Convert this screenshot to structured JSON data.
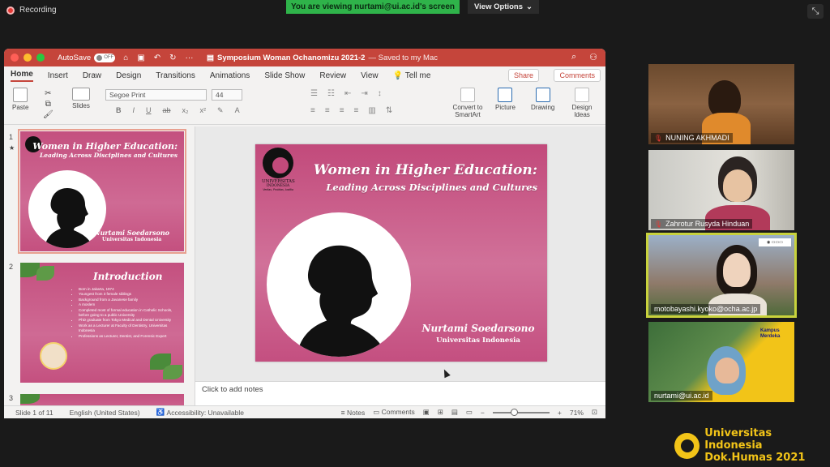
{
  "zoom": {
    "recording_label": "Recording",
    "viewing_banner": "You are viewing nurtami@ui.ac.id's screen",
    "view_options": "View Options"
  },
  "ppt": {
    "autosave_label": "AutoSave",
    "autosave_state": "OFF",
    "doc_title": "Symposium Woman Ochanomizu 2021-2",
    "doc_status": "— Saved to my Mac",
    "tabs": [
      "Home",
      "Insert",
      "Draw",
      "Design",
      "Transitions",
      "Animations",
      "Slide Show",
      "Review",
      "View",
      "Tell me"
    ],
    "share_label": "Share",
    "comments_label": "Comments",
    "ribbon": {
      "paste": "Paste",
      "slides": "Slides",
      "font_name": "Segoe Print",
      "font_size": "44",
      "convert_smartart": "Convert to SmartArt",
      "picture": "Picture",
      "drawing": "Drawing",
      "design_ideas": "Design Ideas"
    },
    "slide1": {
      "title_line1": "Women in Higher Education:",
      "title_line2": "Leading Across Disciplines and Cultures",
      "name": "Nurtami Soedarsono",
      "affiliation": "Universitas Indonesia",
      "logo_line1": "UNIVERSITAS",
      "logo_line2": "INDONESIA",
      "logo_line3": "Veritas, Probitas, Iustitia"
    },
    "slide2": {
      "title": "Introduction",
      "bullets": [
        "Born in Jakarta, 1974",
        "Youngest from 3 female siblings",
        "Background from a Javanese family",
        "A moslem",
        "Completed most of formal education in Catholic Schools, before going to a public University",
        "PhD graduate from Tokyo Medical and Dental University",
        "Work as a Lecturer at Faculty of Dentistry, Universitas Indonesia",
        "Professions as Lecturer, Dentist, and Forensic Expert"
      ]
    },
    "slide_numbers": [
      "1",
      "2",
      "3"
    ],
    "notes_placeholder": "Click to add notes",
    "status": {
      "slide_of": "Slide 1 of 11",
      "language": "English (United States)",
      "accessibility": "Accessibility: Unavailable",
      "notes": "Notes",
      "comments": "Comments",
      "zoom_level": "71%"
    }
  },
  "participants": [
    {
      "name": "NUNING AKHMADI"
    },
    {
      "name": "Zahrotur Rusyda Hinduan"
    },
    {
      "name": "motobayashi.kyoko@ocha.ac.jp"
    },
    {
      "name": "nurtami@ui.ac.id"
    }
  ],
  "participant_overlays": {
    "kampus": "Kampus Merdeka"
  },
  "watermark": {
    "line1": "Universitas Indonesia",
    "line2": "Dok.Humas 2021"
  },
  "colors": {
    "zoom_green": "#2fb34a",
    "ppt_red": "#c5453b",
    "slide_pink": "#c24a7b",
    "active_speaker": "#c8d23c",
    "watermark_gold": "#f2c418"
  }
}
